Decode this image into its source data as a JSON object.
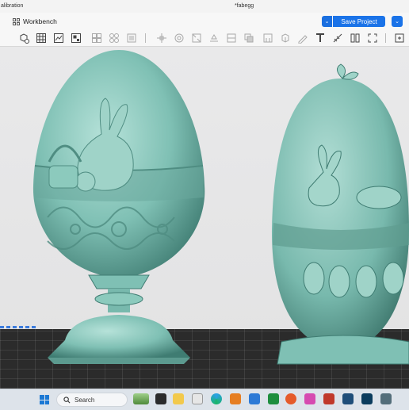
{
  "window": {
    "app_title_partial": "alibration",
    "file_title": "*fabegg"
  },
  "header": {
    "workbench_label": "Workbench",
    "save_label": "Save Project"
  },
  "taskbar": {
    "search_placeholder": "Search"
  },
  "colors": {
    "accent": "#1a73e8",
    "model": "#7fc0b4",
    "bed": "#2b2b2b",
    "viewport_bg": "#e6e6e8"
  },
  "icons": [
    "add-object-icon",
    "grid-view-icon",
    "slice-icon",
    "arrange-icon",
    "orient-icon",
    "move-icon",
    "rotate-icon",
    "scale-icon",
    "cut-icon",
    "boolean-icon",
    "support-icon",
    "paint-icon",
    "seam-icon",
    "text-icon",
    "measure-icon",
    "split-icon",
    "assembly-icon"
  ]
}
